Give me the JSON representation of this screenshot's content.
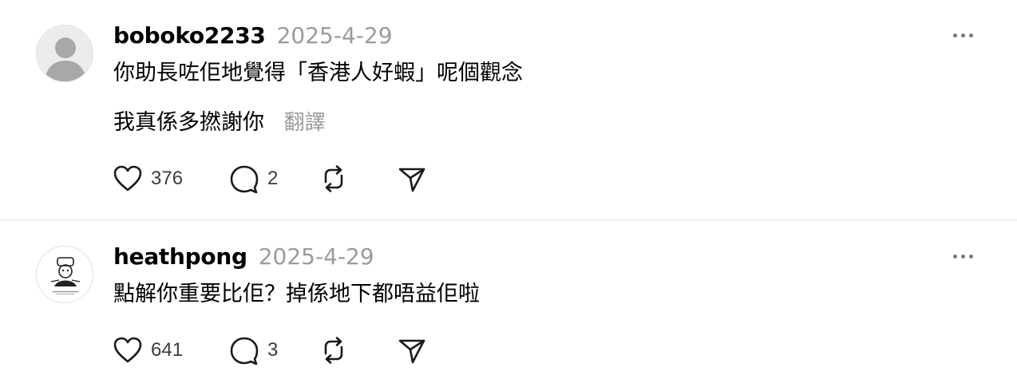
{
  "posts": [
    {
      "username": "boboko2233",
      "date": "2025-4-29",
      "lines": [
        "你助長咗佢地覺得「香港人好蝦」呢個觀念",
        "我真係多撚謝你"
      ],
      "translate_label": "翻譯",
      "likes": "376",
      "replies": "2",
      "avatar_icon": "default-person-avatar"
    },
    {
      "username": "heathpong",
      "date": "2025-4-29",
      "lines": [
        "點解你重要比佢？￼掉係地下都唔益佢啦"
      ],
      "likes": "641",
      "replies": "3",
      "avatar_icon": "custom-drawing-avatar"
    }
  ],
  "icons": {
    "like": "heart-icon",
    "reply": "speech-bubble-icon",
    "repost": "repost-icon",
    "share": "send-icon",
    "more": "ellipsis-icon"
  },
  "colors": {
    "text": "#000000",
    "secondary": "#9b9b9b",
    "icon": "#1a1a1a",
    "divider": "#e6e6e6"
  }
}
